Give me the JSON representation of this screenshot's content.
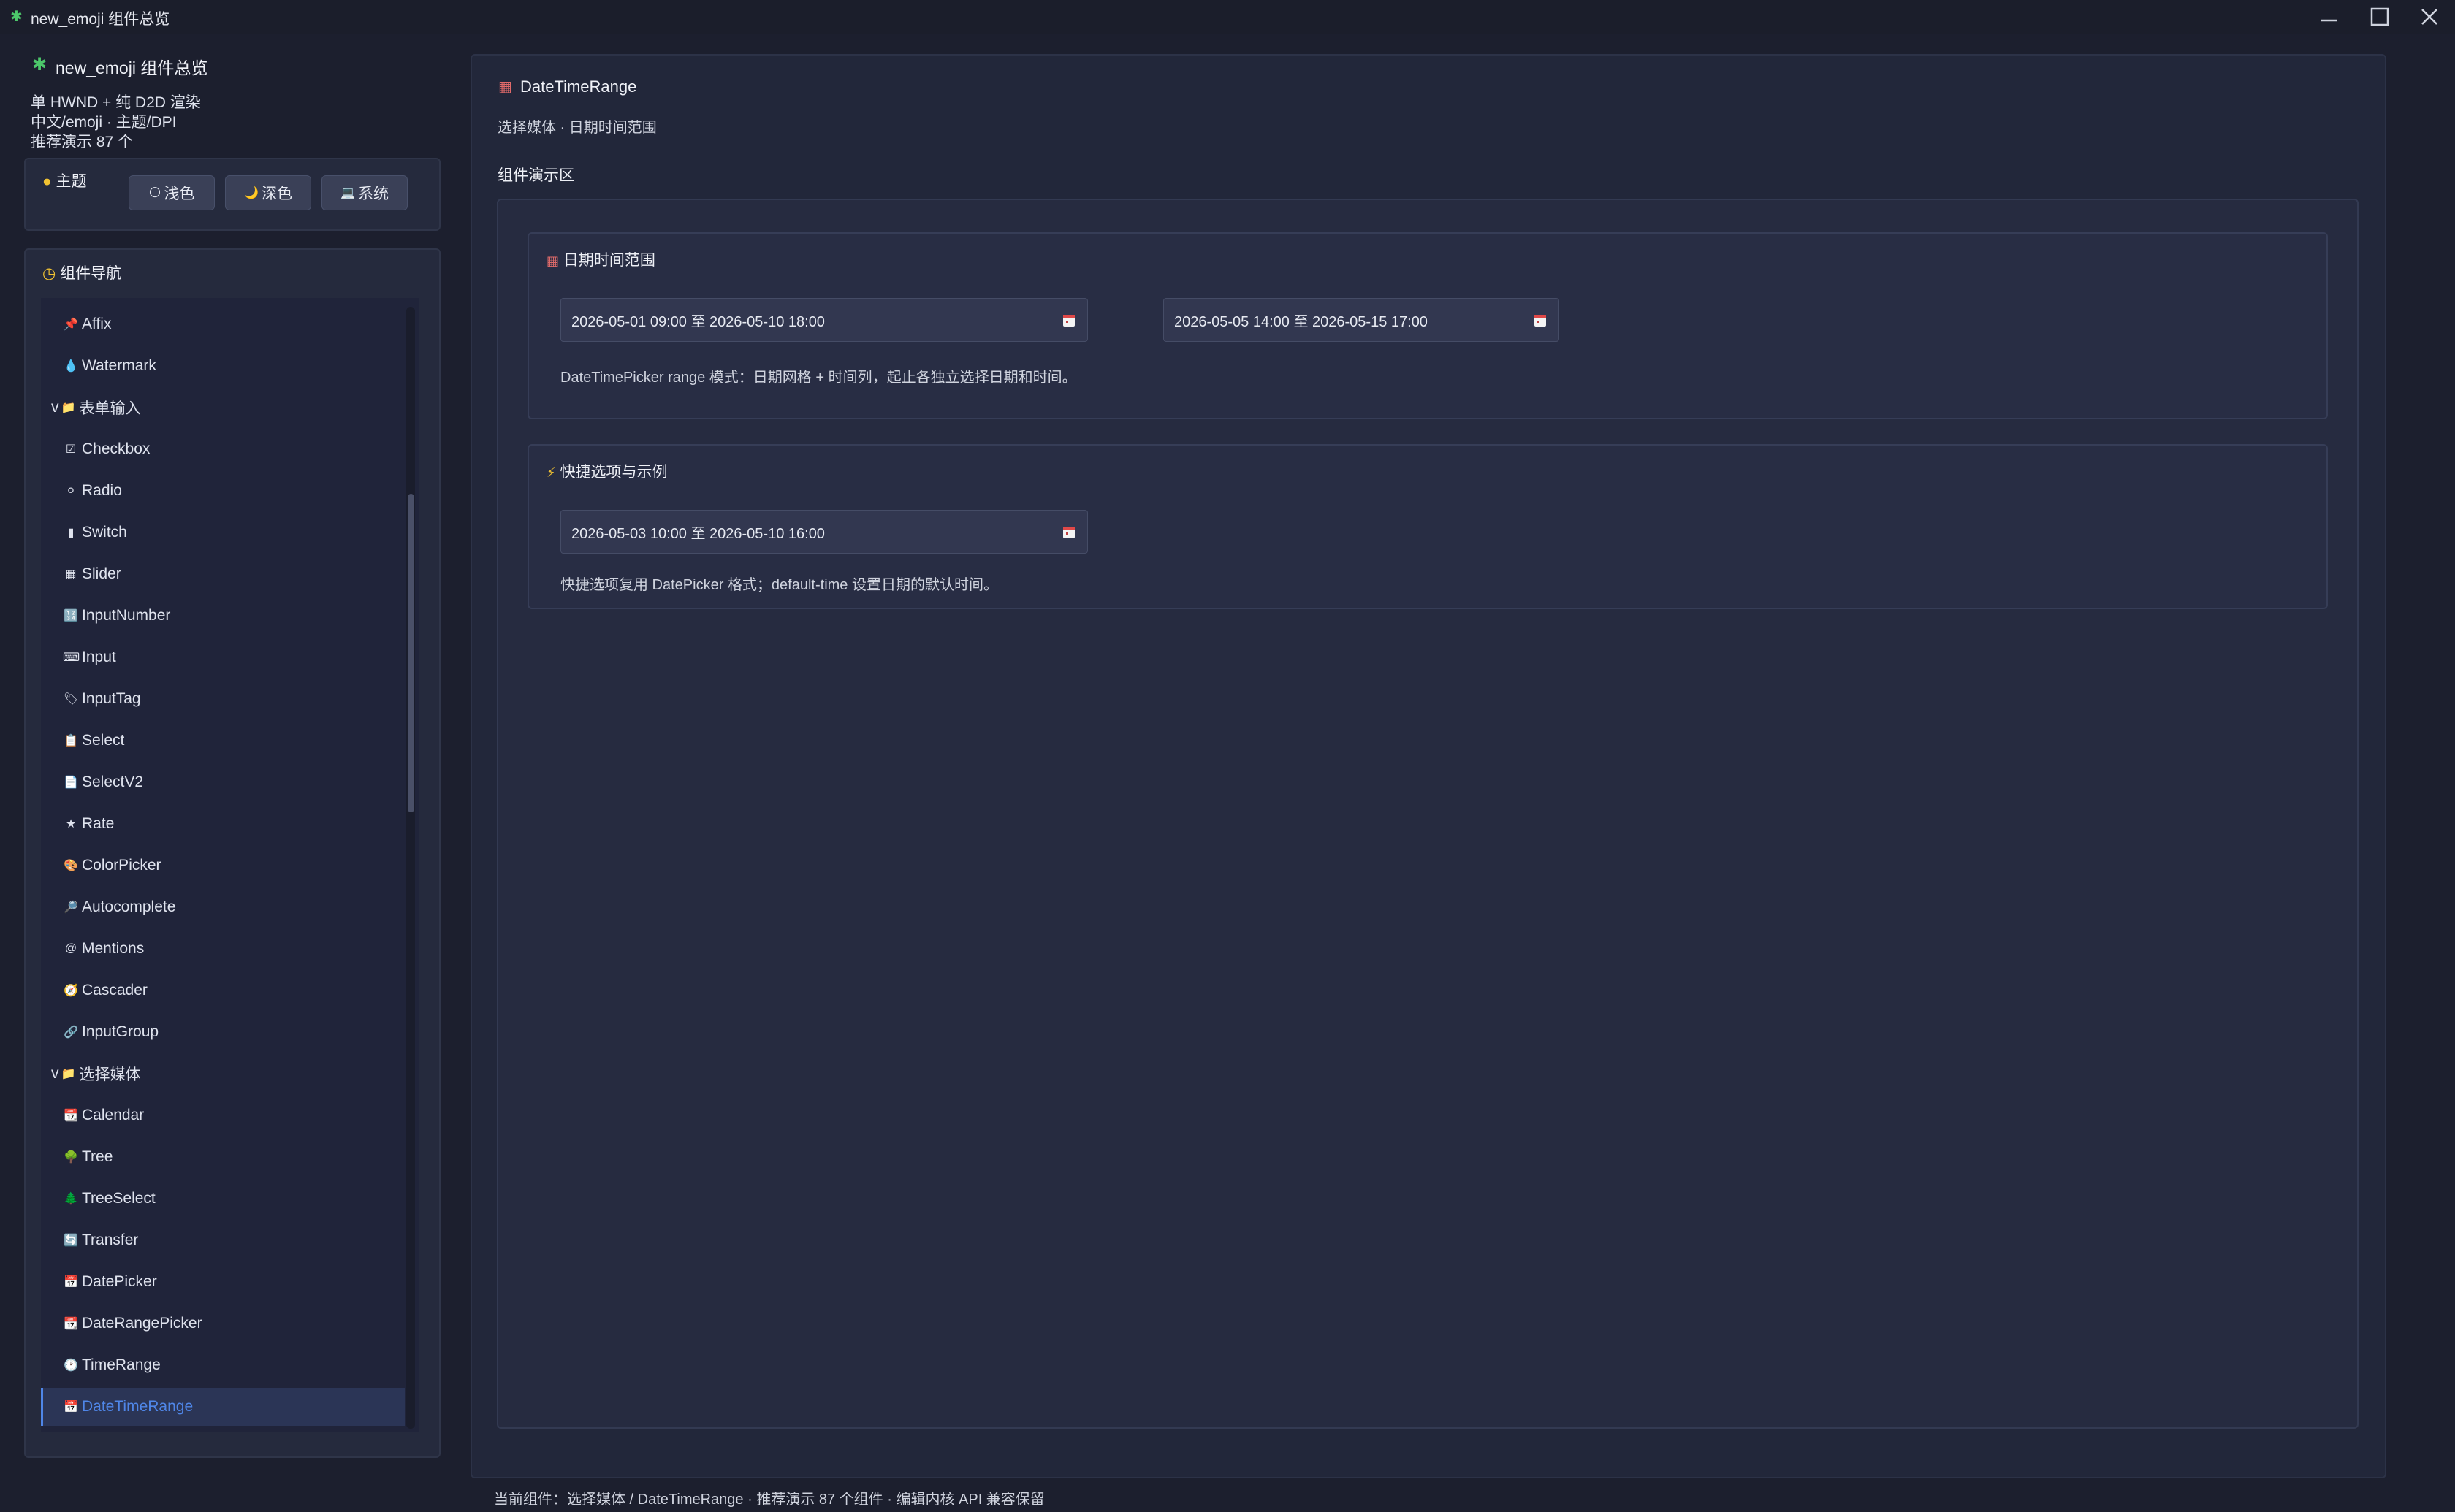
{
  "window": {
    "title": "new_emoji 组件总览"
  },
  "sidebar": {
    "app_title": "new_emoji 组件总览",
    "info_lines": [
      "单 HWND + 纯 D2D 渲染",
      "中文/emoji · 主题/DPI",
      "推荐演示 87 个"
    ],
    "theme": {
      "label": "主题",
      "buttons": [
        {
          "icon": "🌕",
          "label": "浅色"
        },
        {
          "icon": "🌙",
          "label": "深色"
        },
        {
          "icon": "💻",
          "label": "系统"
        }
      ]
    },
    "nav": {
      "title": "组件导航",
      "items": [
        {
          "icon": "📌",
          "label": "Affix"
        },
        {
          "icon": "💧",
          "label": "Watermark"
        },
        {
          "icon": "📁",
          "label": "表单输入",
          "prefix": "v"
        },
        {
          "icon": "☑",
          "label": "Checkbox"
        },
        {
          "icon": "⚪",
          "label": "Radio"
        },
        {
          "icon": "▮",
          "label": "Switch"
        },
        {
          "icon": "▦",
          "label": "Slider"
        },
        {
          "icon": "🔢",
          "label": "InputNumber"
        },
        {
          "icon": "⌨",
          "label": "Input"
        },
        {
          "icon": "🏷",
          "label": "InputTag"
        },
        {
          "icon": "📋",
          "label": "Select"
        },
        {
          "icon": "📄",
          "label": "SelectV2"
        },
        {
          "icon": "★",
          "label": "Rate"
        },
        {
          "icon": "🎨",
          "label": "ColorPicker"
        },
        {
          "icon": "🔎",
          "label": "Autocomplete"
        },
        {
          "icon": "@",
          "label": "Mentions"
        },
        {
          "icon": "🧭",
          "label": "Cascader"
        },
        {
          "icon": "🔗",
          "label": "InputGroup"
        },
        {
          "icon": "📁",
          "label": "选择媒体",
          "prefix": "v"
        },
        {
          "icon": "📆",
          "label": "Calendar"
        },
        {
          "icon": "🌳",
          "label": "Tree"
        },
        {
          "icon": "🌲",
          "label": "TreeSelect"
        },
        {
          "icon": "🔄",
          "label": "Transfer"
        },
        {
          "icon": "📅",
          "label": "DatePicker"
        },
        {
          "icon": "📆",
          "label": "DateRangePicker"
        },
        {
          "icon": "🕑",
          "label": "TimeRange"
        },
        {
          "icon": "📅",
          "label": "DateTimeRange"
        }
      ]
    }
  },
  "main": {
    "title": "DateTimeRange",
    "subtitle": "选择媒体 · 日期时间范围",
    "demo_label": "组件演示区",
    "sections": [
      {
        "title": "日期时间范围",
        "inputs": [
          "2026-05-01 09:00 至 2026-05-10 18:00",
          "2026-05-05 14:00 至 2026-05-15 17:00"
        ],
        "description": "DateTimePicker range 模式：日期网格 + 时间列，起止各独立选择日期和时间。"
      },
      {
        "title": "快捷选项与示例",
        "inputs": [
          "2026-05-03 10:00 至 2026-05-10 16:00"
        ],
        "description": "快捷选项复用 DatePicker 格式；default-time 设置日期的默认时间。"
      }
    ]
  },
  "statusbar": {
    "text": "当前组件：选择媒体 / DateTimeRange · 推荐演示 87 个组件 · 编辑内核 API 兼容保留"
  },
  "colors": {
    "background": "#1c1f2e",
    "accent": "#4f86e8",
    "panel": "#22273a"
  }
}
